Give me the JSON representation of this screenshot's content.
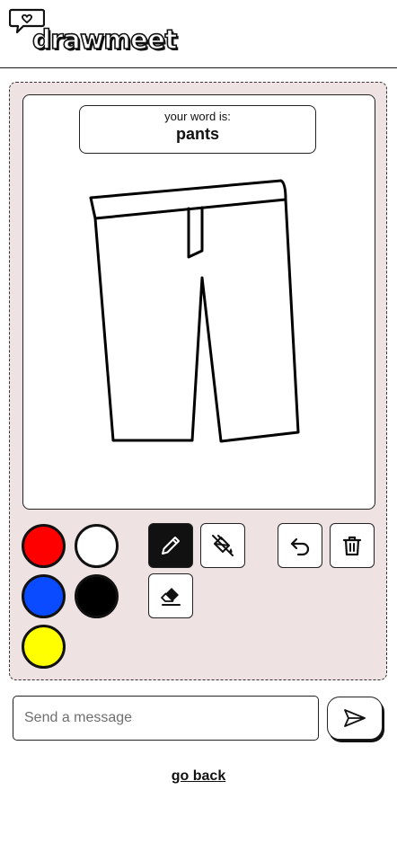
{
  "app": {
    "logo_text": "drawmeet"
  },
  "prompt": {
    "label": "your word is:",
    "word": "pants"
  },
  "palette": {
    "colors": [
      {
        "name": "red",
        "hex": "#ff0000"
      },
      {
        "name": "white",
        "hex": "#ffffff"
      },
      {
        "name": "blue",
        "hex": "#0a4bff"
      },
      {
        "name": "black",
        "hex": "#000000"
      },
      {
        "name": "yellow",
        "hex": "#ffff00"
      }
    ]
  },
  "tools": {
    "active": "pencil",
    "items": [
      "pencil-icon",
      "paint-bucket-icon",
      "eraser-icon",
      "undo-icon",
      "trash-icon"
    ]
  },
  "chat": {
    "placeholder": "Send a message",
    "send_icon": "send-icon"
  },
  "nav": {
    "go_back_label": "go back"
  },
  "theme": {
    "panel_bg": "#efe2e2",
    "active_tool_bg": "#111111"
  }
}
